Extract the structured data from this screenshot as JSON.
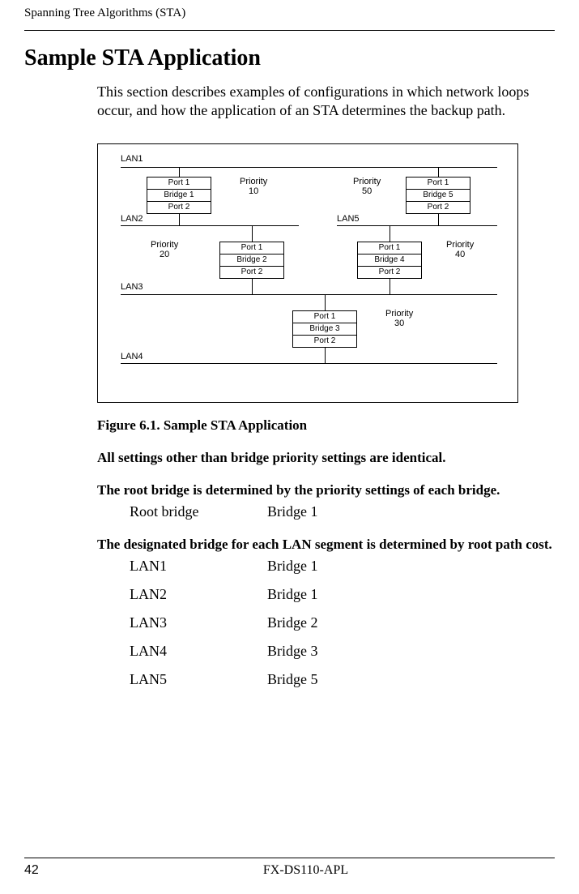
{
  "header": {
    "running_head": "Spanning Tree Algorithms (STA)"
  },
  "title": "Sample STA Application",
  "intro": "This section describes examples of configurations in which network loops occur, and how the application of an STA determines the backup path.",
  "figure": {
    "lan1": "LAN1",
    "lan2": "LAN2",
    "lan3": "LAN3",
    "lan4": "LAN4",
    "lan5": "LAN5",
    "bridge1": {
      "port1": "Port 1",
      "name": "Bridge 1",
      "port2": "Port 2"
    },
    "bridge2": {
      "port1": "Port 1",
      "name": "Bridge 2",
      "port2": "Port 2"
    },
    "bridge3": {
      "port1": "Port 1",
      "name": "Bridge 3",
      "port2": "Port 2"
    },
    "bridge4": {
      "port1": "Port 1",
      "name": "Bridge 4",
      "port2": "Port 2"
    },
    "bridge5": {
      "port1": "Port 1",
      "name": "Bridge 5",
      "port2": "Port 2"
    },
    "pri10a": "Priority",
    "pri10b": "10",
    "pri20a": "Priority",
    "pri20b": "20",
    "pri30a": "Priority",
    "pri30b": "30",
    "pri40a": "Priority",
    "pri40b": "40",
    "pri50a": "Priority",
    "pri50b": "50"
  },
  "caption": "Figure 6.1.   Sample STA Application",
  "para1": "All settings other than bridge priority settings are identical.",
  "para2": "The root bridge is determined by the priority settings of each bridge.",
  "root_row": {
    "k": "Root bridge",
    "v": "Bridge 1"
  },
  "para3": "The designated bridge for each LAN segment is determined by root path cost.",
  "rows": [
    {
      "k": "LAN1",
      "v": "Bridge 1"
    },
    {
      "k": "LAN2",
      "v": "Bridge 1"
    },
    {
      "k": "LAN3",
      "v": "Bridge 2"
    },
    {
      "k": "LAN4",
      "v": "Bridge 3"
    },
    {
      "k": "LAN5",
      "v": "Bridge 5"
    }
  ],
  "footer": {
    "page": "42",
    "doc": "FX-DS110-APL"
  }
}
